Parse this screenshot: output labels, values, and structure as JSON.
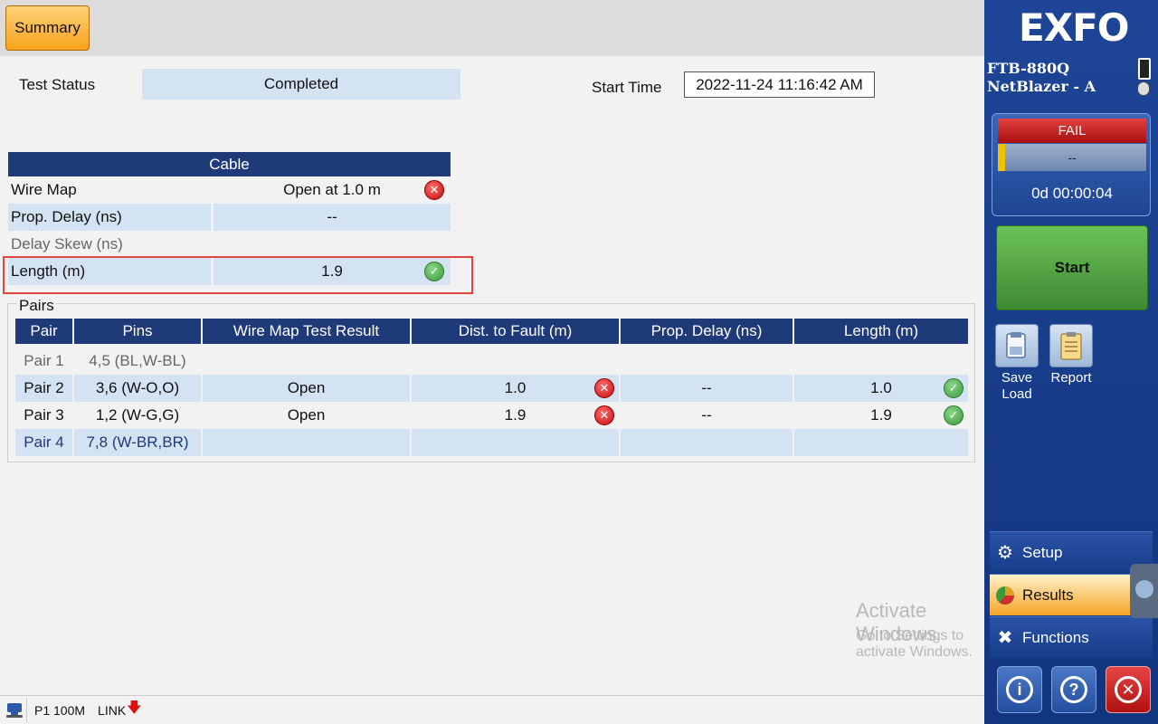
{
  "header": {
    "summary_label": "Summary"
  },
  "status": {
    "test_status_label": "Test Status",
    "test_status_value": "Completed",
    "start_time_label": "Start Time",
    "start_time_value": "2022-11-24 11:16:42 AM"
  },
  "cable": {
    "title": "Cable",
    "rows": [
      {
        "label": "Wire Map",
        "value": "Open at 1.0 m",
        "icon": "fail-icon"
      },
      {
        "label": "Prop. Delay (ns)",
        "value": "--",
        "icon": ""
      },
      {
        "label": "Delay Skew (ns)",
        "value": "",
        "icon": ""
      },
      {
        "label": "Length (m)",
        "value": "1.9",
        "icon": "pass-icon"
      }
    ]
  },
  "pairs": {
    "title": "Pairs",
    "headers": [
      "Pair",
      "Pins",
      "Wire Map Test Result",
      "Dist. to Fault (m)",
      "Prop. Delay (ns)",
      "Length (m)"
    ],
    "rows": [
      {
        "pair": "Pair 1",
        "pins": "4,5 (BL,W-BL)",
        "result": "",
        "dist": "",
        "delay": "",
        "length": ""
      },
      {
        "pair": "Pair 2",
        "pins": "3,6 (W-O,O)",
        "result": "Open",
        "dist": "1.0",
        "delay": "--",
        "length": "1.0"
      },
      {
        "pair": "Pair 3",
        "pins": "1,2 (W-G,G)",
        "result": "Open",
        "dist": "1.9",
        "delay": "--",
        "length": "1.9"
      },
      {
        "pair": "Pair 4",
        "pins": "7,8 (W-BR,BR)",
        "result": "",
        "dist": "",
        "delay": "",
        "length": ""
      }
    ]
  },
  "watermark": {
    "line1": "Activate Windows",
    "line2": "Go to Settings to activate Windows."
  },
  "statusbar": {
    "port": "P1 100M",
    "link": "LINK"
  },
  "panel": {
    "logo": "EXFO",
    "model_line1": "FTB-880Q",
    "model_line2": "NetBlazer  - A",
    "verdict": "FAIL",
    "sub_value": "--",
    "elapsed": "0d 00:00:04",
    "start_label": "Start",
    "save_load_label_1": "Save",
    "save_load_label_2": "Load",
    "report_label": "Report",
    "nav": [
      {
        "label": "Setup",
        "icon": "gear-icon"
      },
      {
        "label": "Results",
        "icon": "pie-chart-icon"
      },
      {
        "label": "Functions",
        "icon": "tools-icon"
      }
    ]
  },
  "colors": {
    "accent": "#1f3a78",
    "fail": "#c21010",
    "pass": "#3b9a3b",
    "start": "#4f9e40",
    "active_nav": "#f6a326"
  }
}
